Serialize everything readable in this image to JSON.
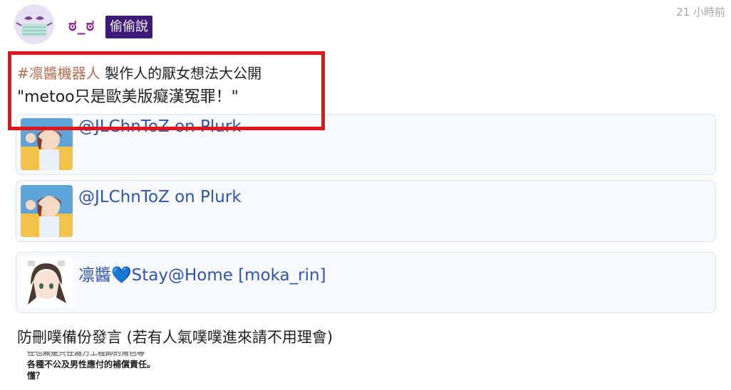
{
  "header": {
    "username": "ಠ_ಠ",
    "badge": "偷偷說",
    "timestamp": "21 小時前"
  },
  "post": {
    "hashtag": "#凛醬機器人",
    "line1_rest": " 製作人的厭女想法大公開",
    "line2": "\"metoo只是歐美版癡漢冤罪！\""
  },
  "cards": [
    {
      "title": "@JLChnToZ on Plurk",
      "thumb_icon": "anime-girl-thumbnail"
    },
    {
      "title": "@JLChnToZ on Plurk",
      "thumb_icon": "anime-girl-thumbnail"
    },
    {
      "title": "凛醬💙Stay@Home [moka_rin]",
      "thumb_icon": "anime-girl-headphones-thumbnail"
    }
  ],
  "footer_text": "防刪噗備份發言 (若有人氣噗噗進來請不用理會)",
  "snippet": {
    "lines": [
      "任也無是只任為万工程師的角色等",
      "各種不公及男性應付的補償責任。",
      "懂？"
    ]
  },
  "colors": {
    "username": "#8b2a8f",
    "badge_bg": "#3b1a7a",
    "hashtag": "#b56d4d",
    "link": "#2e55a8",
    "highlight": "#e3151a"
  }
}
